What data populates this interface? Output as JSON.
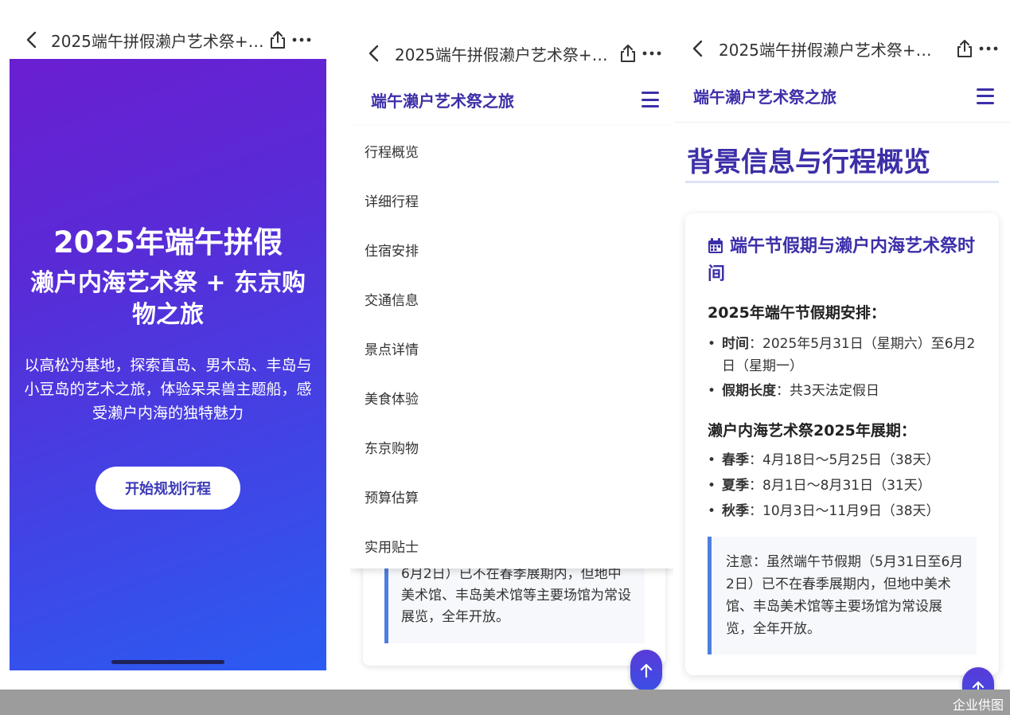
{
  "common": {
    "page_title": "2025端午拼假濑户艺术祭+…"
  },
  "screen1": {
    "hero_title": "2025年端午拼假",
    "hero_subtitle": "濑户内海艺术祭 + 东京购物之旅",
    "hero_desc": "以高松为基地，探索直岛、男木岛、丰岛与小豆岛的艺术之旅，体验呆呆兽主题船，感受濑户内海的独特魅力",
    "cta": "开始规划行程"
  },
  "screen2": {
    "brand": "端午濑户艺术祭之旅",
    "menu": [
      "行程概览",
      "详细行程",
      "住宿安排",
      "交通信息",
      "景点详情",
      "美食体验",
      "东京购物",
      "预算估算",
      "实用贴士"
    ],
    "under_note": "6月2日）已不在春季展期内，但地中美术馆、丰岛美术馆等主要场馆为常设展览，全年开放。"
  },
  "screen3": {
    "brand": "端午濑户艺术祭之旅",
    "section_title": "背景信息与行程概览",
    "card_title": "端午节假期与濑户内海艺术祭时间",
    "holiday_heading": "2025年端午节假期安排：",
    "holiday_items": [
      {
        "label": "时间",
        "text": "：2025年5月31日（星期六）至6月2日（星期一）"
      },
      {
        "label": "假期长度",
        "text": "：共3天法定假日"
      }
    ],
    "festival_heading": "濑户内海艺术祭2025年展期：",
    "festival_items": [
      {
        "label": "春季",
        "text": "：4月18日～5月25日（38天）"
      },
      {
        "label": "夏季",
        "text": "：8月1日～8月31日（31天）"
      },
      {
        "label": "秋季",
        "text": "：10月3日～11月9日（38天）"
      }
    ],
    "note": "注意：虽然端午节假期（5月31日至6月2日）已不在春季展期内，但地中美术馆、丰岛美术馆等主要场馆为常设展览，全年开放。"
  },
  "credit": "企业供图",
  "colors": {
    "brand": "#3c2fa8",
    "hero_start": "#6a1fd1",
    "hero_end": "#2a5cf2",
    "note_border": "#4d7fe0"
  }
}
